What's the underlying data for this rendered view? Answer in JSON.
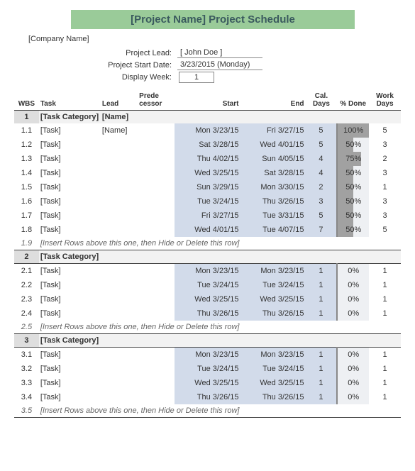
{
  "title": "[Project Name] Project Schedule",
  "company": "[Company Name]",
  "meta": {
    "lead_label": "Project Lead:",
    "lead_value": "[ John Doe ]",
    "start_label": "Project Start Date:",
    "start_value": "3/23/2015 (Monday)",
    "week_label": "Display Week:",
    "week_value": "1"
  },
  "headers": {
    "wbs": "WBS",
    "task": "Task",
    "lead": "Lead",
    "pred": "Prede cessor",
    "start": "Start",
    "end": "End",
    "cal": "Cal. Days",
    "pct": "% Done",
    "work": "Work Days"
  },
  "sections": [
    {
      "wbs": "1",
      "category": "[Task Category]",
      "lead": "[Name]",
      "rows": [
        {
          "wbs": "1.1",
          "task": "[Task]",
          "lead": "[Name]",
          "start": "Mon 3/23/15",
          "end": "Fri 3/27/15",
          "cal": "5",
          "pct": "100%",
          "pct_w": 100,
          "work": "5"
        },
        {
          "wbs": "1.2",
          "task": "[Task]",
          "lead": "",
          "start": "Sat 3/28/15",
          "end": "Wed 4/01/15",
          "cal": "5",
          "pct": "50%",
          "pct_w": 50,
          "work": "3"
        },
        {
          "wbs": "1.3",
          "task": "[Task]",
          "lead": "",
          "start": "Thu 4/02/15",
          "end": "Sun 4/05/15",
          "cal": "4",
          "pct": "75%",
          "pct_w": 75,
          "work": "2"
        },
        {
          "wbs": "1.4",
          "task": "[Task]",
          "lead": "",
          "start": "Wed 3/25/15",
          "end": "Sat 3/28/15",
          "cal": "4",
          "pct": "50%",
          "pct_w": 50,
          "work": "3"
        },
        {
          "wbs": "1.5",
          "task": "[Task]",
          "lead": "",
          "start": "Sun 3/29/15",
          "end": "Mon 3/30/15",
          "cal": "2",
          "pct": "50%",
          "pct_w": 50,
          "work": "1"
        },
        {
          "wbs": "1.6",
          "task": "[Task]",
          "lead": "",
          "start": "Tue 3/24/15",
          "end": "Thu 3/26/15",
          "cal": "3",
          "pct": "50%",
          "pct_w": 50,
          "work": "3"
        },
        {
          "wbs": "1.7",
          "task": "[Task]",
          "lead": "",
          "start": "Fri 3/27/15",
          "end": "Tue 3/31/15",
          "cal": "5",
          "pct": "50%",
          "pct_w": 50,
          "work": "3"
        },
        {
          "wbs": "1.8",
          "task": "[Task]",
          "lead": "",
          "start": "Wed 4/01/15",
          "end": "Tue 4/07/15",
          "cal": "7",
          "pct": "50%",
          "pct_w": 50,
          "work": "5"
        }
      ],
      "insert_wbs": "1.9",
      "insert_note": "[Insert Rows above this one, then Hide or Delete this row]"
    },
    {
      "wbs": "2",
      "category": "[Task Category]",
      "lead": "",
      "rows": [
        {
          "wbs": "2.1",
          "task": "[Task]",
          "lead": "",
          "start": "Mon 3/23/15",
          "end": "Mon 3/23/15",
          "cal": "1",
          "pct": "0%",
          "pct_w": 0,
          "work": "1"
        },
        {
          "wbs": "2.2",
          "task": "[Task]",
          "lead": "",
          "start": "Tue 3/24/15",
          "end": "Tue 3/24/15",
          "cal": "1",
          "pct": "0%",
          "pct_w": 0,
          "work": "1"
        },
        {
          "wbs": "2.3",
          "task": "[Task]",
          "lead": "",
          "start": "Wed 3/25/15",
          "end": "Wed 3/25/15",
          "cal": "1",
          "pct": "0%",
          "pct_w": 0,
          "work": "1"
        },
        {
          "wbs": "2.4",
          "task": "[Task]",
          "lead": "",
          "start": "Thu 3/26/15",
          "end": "Thu 3/26/15",
          "cal": "1",
          "pct": "0%",
          "pct_w": 0,
          "work": "1"
        }
      ],
      "insert_wbs": "2.5",
      "insert_note": "[Insert Rows above this one, then Hide or Delete this row]"
    },
    {
      "wbs": "3",
      "category": "[Task Category]",
      "lead": "",
      "rows": [
        {
          "wbs": "3.1",
          "task": "[Task]",
          "lead": "",
          "start": "Mon 3/23/15",
          "end": "Mon 3/23/15",
          "cal": "1",
          "pct": "0%",
          "pct_w": 0,
          "work": "1"
        },
        {
          "wbs": "3.2",
          "task": "[Task]",
          "lead": "",
          "start": "Tue 3/24/15",
          "end": "Tue 3/24/15",
          "cal": "1",
          "pct": "0%",
          "pct_w": 0,
          "work": "1"
        },
        {
          "wbs": "3.3",
          "task": "[Task]",
          "lead": "",
          "start": "Wed 3/25/15",
          "end": "Wed 3/25/15",
          "cal": "1",
          "pct": "0%",
          "pct_w": 0,
          "work": "1"
        },
        {
          "wbs": "3.4",
          "task": "[Task]",
          "lead": "",
          "start": "Thu 3/26/15",
          "end": "Thu 3/26/15",
          "cal": "1",
          "pct": "0%",
          "pct_w": 0,
          "work": "1"
        }
      ],
      "insert_wbs": "3.5",
      "insert_note": "[Insert Rows above this one, then Hide or Delete this row]"
    }
  ]
}
